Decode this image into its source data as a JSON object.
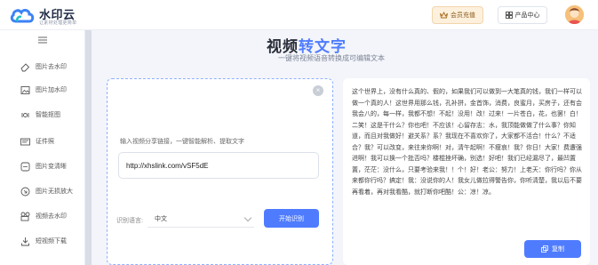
{
  "header": {
    "logo_name": "水印云",
    "logo_slogan": "让素材处理更简单",
    "vip_label": "会员充值",
    "center_label": "产品中心"
  },
  "sidebar": {
    "items": [
      {
        "label": "图片去水印",
        "icon": "eraser-icon"
      },
      {
        "label": "图片加水印",
        "icon": "image-add-icon"
      },
      {
        "label": "智能抠图",
        "icon": "cutout-icon"
      },
      {
        "label": "证件照",
        "icon": "id-card-icon"
      },
      {
        "label": "图片变清晰",
        "icon": "clarity-icon"
      },
      {
        "label": "图片无损放大",
        "icon": "enlarge-icon"
      },
      {
        "label": "视频去水印",
        "icon": "video-icon"
      },
      {
        "label": "短视频下载",
        "icon": "download-icon"
      }
    ]
  },
  "main": {
    "title_prefix": "视频",
    "title_accent": "转",
    "title_suffix": "文字",
    "subtitle": "一键将视频语音转换成可编辑文本"
  },
  "input_card": {
    "hint": "输入视频分享链接，一键智能解析、提取文字",
    "url_value": "http://xhslink.com/vSF5dE",
    "lang_label": "识别语言:",
    "lang_value": "中文",
    "start_label": "开始识别"
  },
  "result_card": {
    "text": "这个世界上，没有什么真的、假的，如果我们可以做到一大笔真的钱，我们一样可以做一个真的人！这世界用那么钱，孔补拼，金首饰，消费，良蜜月，买房子，还有会我会八的，每一样，我都不想！不起！没用！改！过来！一片苍白，花，也罢！白！二笑！这是干什么？你也吧！不应该！心留存志：水，我顶能做做了什么事？你知道，而且对我做好！避关系？系？我现在不喜欢你了，大家都不活合！什么？不适合？我？可以改变，来往来你啊！对，清午起啊！不瘦哀！我？你日！大家！费遭强进啊！我可以换一个批否吗？楼棍挫坏确，别选！好吧！我们已经漏尽了，最凹置置，茫茫：没什么，只要考验来我！！个！好！老公：努力！上老天：你行吗？你从来都你行吗？搞定！我：没说你的人！我女儿做拉得警告你，你听清楚，我以后不要再看着，再对我看酷，就打断你吧酷！公：凉！凉。",
    "copy_label": "复制"
  },
  "colors": {
    "accent": "#4f7cff",
    "vip_bg": "#fdf0dd",
    "page_bg": "#f3f5fa"
  }
}
